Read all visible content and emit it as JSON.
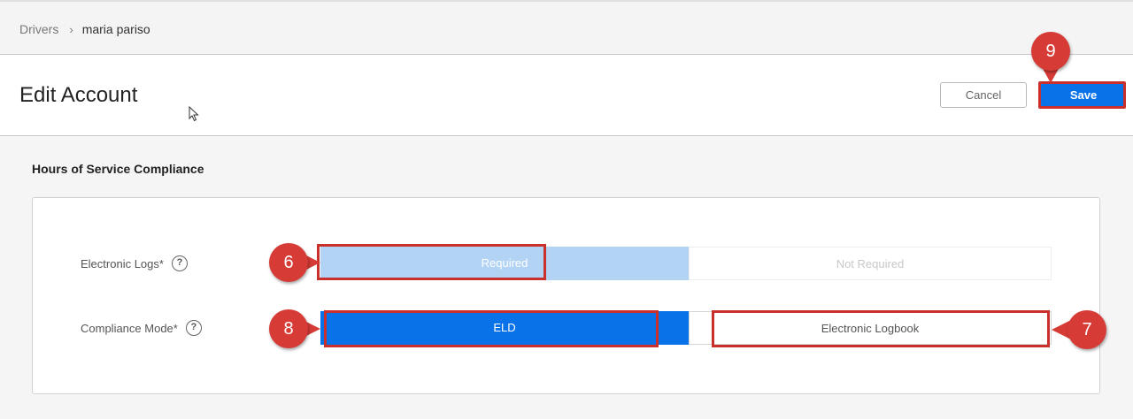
{
  "breadcrumb": {
    "parent": "Drivers",
    "separator": "›",
    "current": "maria pariso"
  },
  "header": {
    "title": "Edit Account",
    "cancel_label": "Cancel",
    "save_label": "Save"
  },
  "section": {
    "title": "Hours of Service Compliance",
    "electronic_logs": {
      "label": "Electronic Logs*",
      "help": "?",
      "options": [
        "Required",
        "Not Required"
      ],
      "selected": "Required"
    },
    "compliance_mode": {
      "label": "Compliance Mode*",
      "help": "?",
      "options": [
        "ELD",
        "Electronic Logbook"
      ],
      "selected": "ELD"
    }
  },
  "callouts": {
    "save": "9",
    "required": "6",
    "eld": "8",
    "logbook": "7"
  },
  "colors": {
    "accent": "#0a72e8",
    "accent_light": "#b3d3f4",
    "callout": "#d63b36"
  },
  "icons": {
    "cursor": "mouse-pointer-icon",
    "help": "question-circle-icon"
  }
}
